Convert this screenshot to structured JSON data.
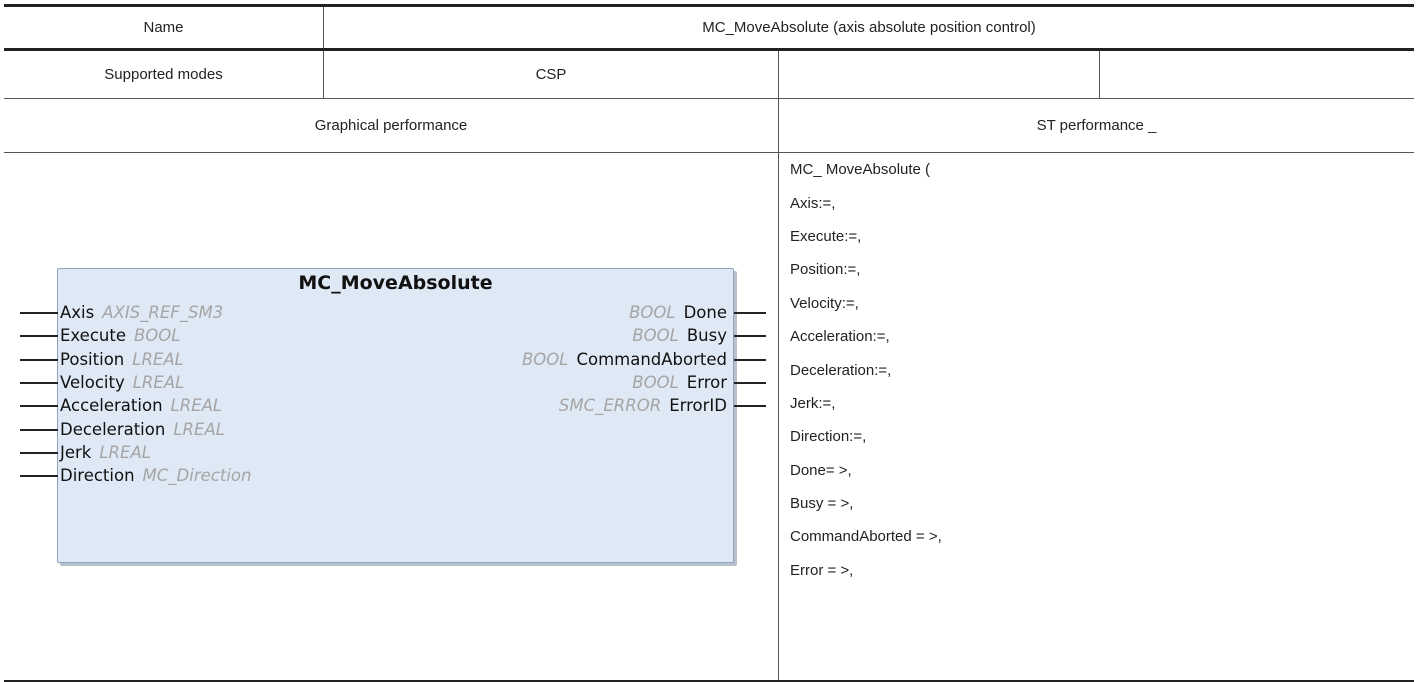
{
  "header": {
    "name_label": "Name",
    "name_value": "MC_MoveAbsolute (axis absolute position control)"
  },
  "modes": {
    "label": "Supported modes",
    "value": "CSP",
    "extra1": "",
    "extra2": ""
  },
  "sections": {
    "graphical": "Graphical performance",
    "st": "ST performance _"
  },
  "function_block": {
    "title": "MC_MoveAbsolute",
    "inputs": [
      {
        "name": "Axis",
        "type": "AXIS_REF_SM3"
      },
      {
        "name": "Execute",
        "type": "BOOL"
      },
      {
        "name": "Position",
        "type": "LREAL"
      },
      {
        "name": "Velocity",
        "type": "LREAL"
      },
      {
        "name": "Acceleration",
        "type": "LREAL"
      },
      {
        "name": "Deceleration",
        "type": "LREAL"
      },
      {
        "name": "Jerk",
        "type": "LREAL"
      },
      {
        "name": "Direction",
        "type": "MC_Direction"
      }
    ],
    "outputs": [
      {
        "name": "Done",
        "type": "BOOL"
      },
      {
        "name": "Busy",
        "type": "BOOL"
      },
      {
        "name": "CommandAborted",
        "type": "BOOL"
      },
      {
        "name": "Error",
        "type": "BOOL"
      },
      {
        "name": "ErrorID",
        "type": "SMC_ERROR"
      }
    ]
  },
  "st_code": [
    "MC_ MoveAbsolute (",
    "Axis:=,",
    "Execute:=,",
    "Position:=,",
    "Velocity:=,",
    "Acceleration:=,",
    "Deceleration:=,",
    "Jerk:=,",
    "Direction:=,",
    "Done= >,",
    "Busy = >,",
    "CommandAborted = >,",
    "Error = >,"
  ]
}
